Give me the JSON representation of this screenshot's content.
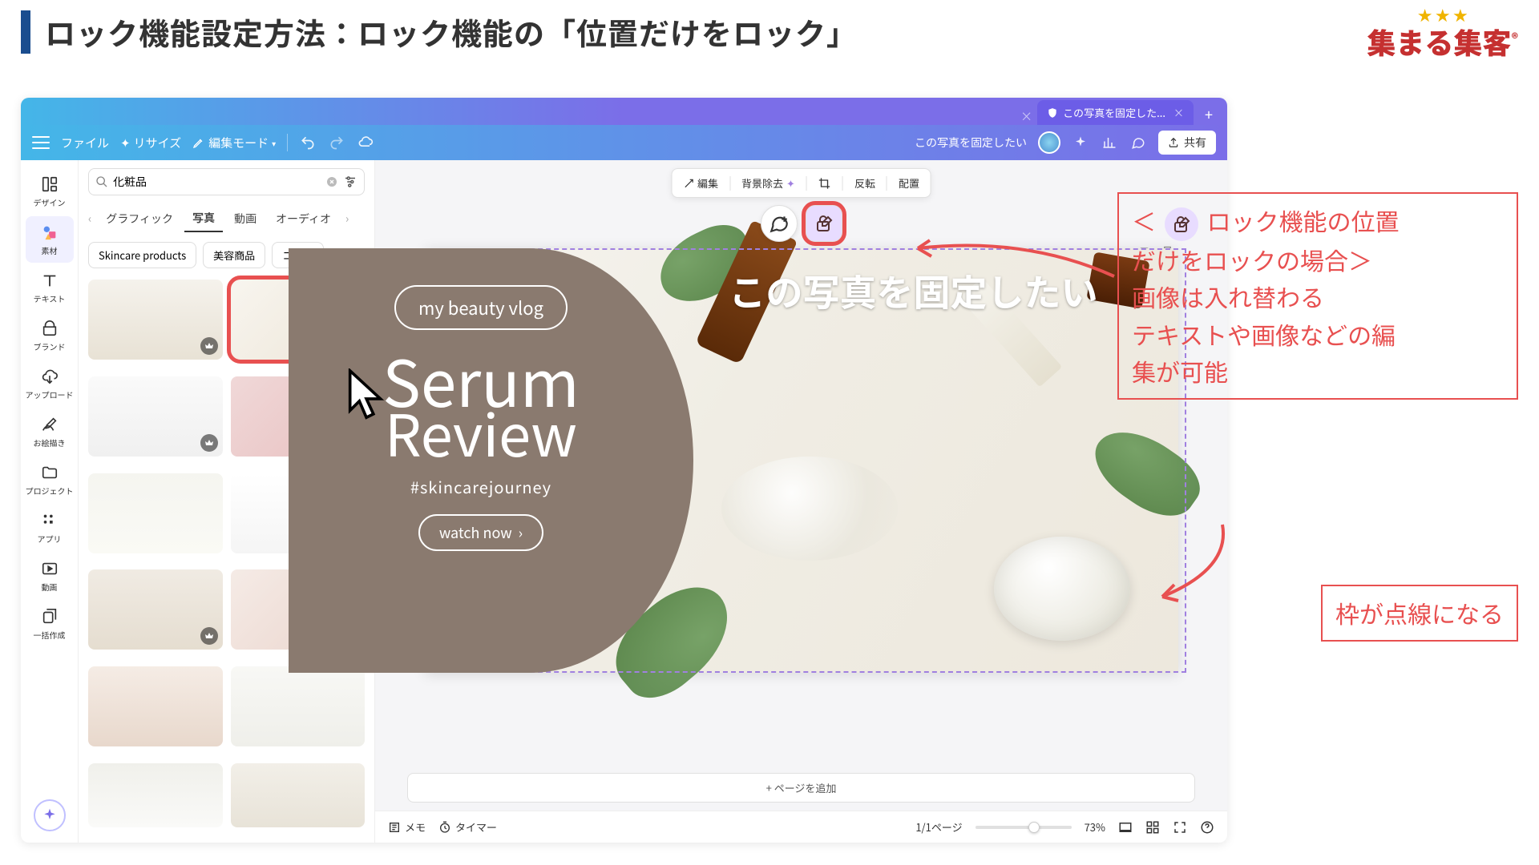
{
  "slide": {
    "title": "ロック機能設定方法：ロック機能の「位置だけをロック」"
  },
  "brand": {
    "name": "集まる集客",
    "tm": "®"
  },
  "browser": {
    "tab_label": "この写真を固定した..."
  },
  "header": {
    "menu_file": "ファイル",
    "menu_resize": "リサイズ",
    "menu_edit_mode": "編集モード",
    "file_title": "この写真を固定したい",
    "share": "共有"
  },
  "rail": {
    "design": "デザイン",
    "elements": "素材",
    "text": "テキスト",
    "brand": "ブランド",
    "upload": "アップロード",
    "draw": "お絵描き",
    "project": "プロジェクト",
    "apps": "アプリ",
    "video": "動画",
    "bulk": "一括作成"
  },
  "search": {
    "value": "化粧品",
    "placeholder": ""
  },
  "asset_tabs": {
    "graphic": "グラフィック",
    "photo": "写真",
    "video": "動画",
    "audio": "オーディオ"
  },
  "chips": {
    "c1": "Skincare products",
    "c2": "美容商品",
    "c3": "コスメ"
  },
  "context": {
    "edit": "編集",
    "bg_remove": "背景除去",
    "flip": "反転",
    "arrange": "配置"
  },
  "canvas": {
    "overlay_text": "この写真を固定したい",
    "pill": "my beauty vlog",
    "script1": "Serum",
    "script2": "Review",
    "hashtag": "#skincarejourney",
    "watch": "watch now",
    "add_page": "+ ページを追加"
  },
  "bottom": {
    "memo": "メモ",
    "timer": "タイマー",
    "page_counter": "1/1ページ",
    "zoom": "73%"
  },
  "annotations": {
    "a1_l1_pre": "＜",
    "a1_l1_post": "ロック機能の位置",
    "a1_l2": "だけをロックの場合＞",
    "a1_l3": "画像は入れ替わる",
    "a1_l4": "テキストや画像などの編",
    "a1_l5": "集が可能",
    "a2": "枠が点線になる"
  }
}
